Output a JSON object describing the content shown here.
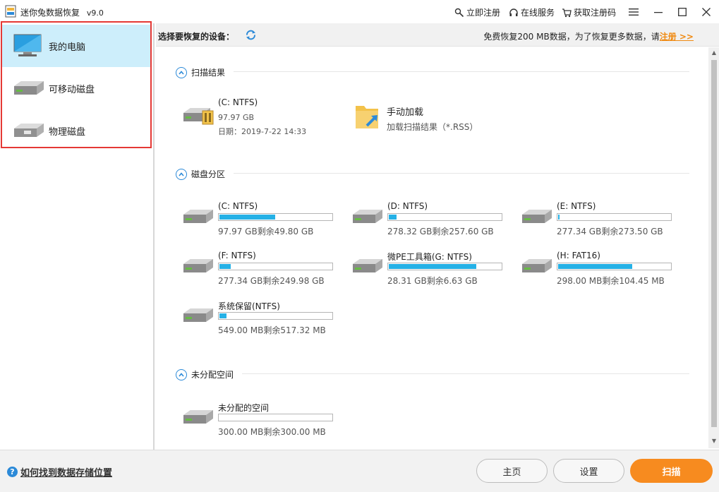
{
  "titlebar": {
    "title": "迷你兔数据恢复",
    "version": "v9.0",
    "register_now": "立即注册",
    "online_service": "在线服务",
    "get_code": "获取注册码"
  },
  "sidebar": {
    "items": [
      {
        "label": "我的电脑",
        "icon": "monitor-icon"
      },
      {
        "label": "可移动磁盘",
        "icon": "removable-disk-icon"
      },
      {
        "label": "物理磁盘",
        "icon": "physical-disk-icon"
      }
    ]
  },
  "topbar": {
    "select_device": "选择要恢复的设备：",
    "free_text": "免费恢复200 MB数据，为了恢复更多数据，请",
    "register_link": "注册 >>"
  },
  "sections": {
    "scan_results": {
      "title": "扫描结果",
      "recent": {
        "name": "(C: NTFS)",
        "size": "97.97 GB",
        "date": "日期：2019-7-22 14:33"
      },
      "manual": {
        "name": "手动加载",
        "desc": "加载扫描结果（*.RSS）"
      }
    },
    "partitions": {
      "title": "磁盘分区",
      "drives": [
        {
          "name": "(C: NTFS)",
          "size": "97.97 GB剩余49.80 GB",
          "used_fraction": 0.49
        },
        {
          "name": "(D: NTFS)",
          "size": "278.32 GB剩余257.60 GB",
          "used_fraction": 0.07
        },
        {
          "name": "(E: NTFS)",
          "size": "277.34 GB剩余273.50 GB",
          "used_fraction": 0.01
        },
        {
          "name": "(F: NTFS)",
          "size": "277.34 GB剩余249.98 GB",
          "used_fraction": 0.1
        },
        {
          "name": "微PE工具箱(G: NTFS)",
          "size": "28.31 GB剩余6.63 GB",
          "used_fraction": 0.77
        },
        {
          "name": "(H: FAT16)",
          "size": "298.00 MB剩余104.45 MB",
          "used_fraction": 0.65
        },
        {
          "name": "系统保留(NTFS)",
          "size": "549.00 MB剩余517.32 MB",
          "used_fraction": 0.06
        }
      ]
    },
    "unallocated": {
      "title": "未分配空间",
      "drive": {
        "name": "未分配的空间",
        "size": "300.00 MB剩余300.00 MB",
        "used_fraction": 0
      }
    }
  },
  "bottombar": {
    "help_label": "如何找到数据存储位置",
    "home": "主页",
    "settings": "设置",
    "scan": "扫描"
  },
  "colors": {
    "accent": "#2c8ad8",
    "usage_bar": "#25b1e6",
    "scan_button": "#f78b1f",
    "sidebar_active": "#cdeefb",
    "highlight": "#e53935"
  }
}
